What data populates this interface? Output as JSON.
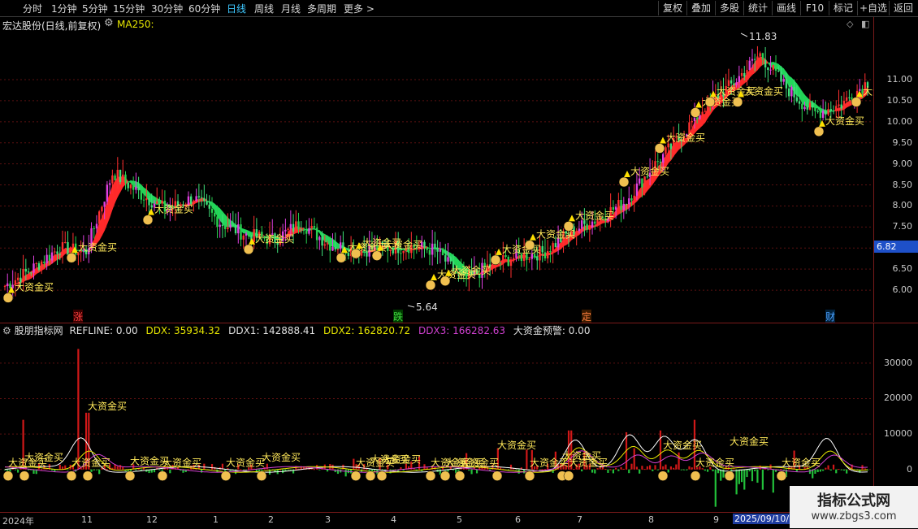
{
  "toolbar": {
    "periods": [
      "分时",
      "1分钟",
      "5分钟",
      "15分钟",
      "30分钟",
      "60分钟",
      "日线",
      "周线",
      "月线",
      "多周期",
      "更多 >"
    ],
    "active_period": "日线",
    "actions": [
      "复权",
      "叠加",
      "多股",
      "统计",
      "画线",
      "F10",
      "标记",
      "+自选",
      "返回"
    ]
  },
  "main_chart": {
    "title": "宏达股份(日线,前复权)",
    "indicator": "MA250:",
    "high_label": "11.83",
    "low_label": "5.64",
    "current_price": "6.82",
    "signal_label": "大资金买",
    "markers": [
      "涨",
      "跌",
      "定",
      "财"
    ]
  },
  "sub_chart": {
    "indicator_name": "股朋指标网",
    "refline": "REFLINE: 0.00",
    "ddx": "DDX: 35934.32",
    "ddx1": "DDX1: 142888.41",
    "ddx2": "DDX2: 162820.72",
    "ddx3": "DDX3: 166282.63",
    "warning": "大资金预警: 0.00"
  },
  "x_axis": {
    "year": "2024年",
    "months": [
      "11",
      "12",
      "1",
      "2",
      "3",
      "4",
      "5",
      "6",
      "7",
      "8",
      "9"
    ],
    "cursor_date": "2025/09/10/3"
  },
  "watermark": {
    "line1": "指标公式网",
    "line2": "www.zbgs3.com"
  },
  "chart_data": [
    {
      "type": "line",
      "title": "宏达股份(日线,前复权)",
      "y_ticks": [
        6.0,
        6.5,
        7.0,
        7.5,
        8.0,
        8.5,
        9.0,
        9.5,
        10.0,
        10.5,
        11.0
      ],
      "ylim": [
        5.5,
        12.1
      ],
      "series": [
        {
          "values": [
            6.1,
            6.5,
            7.0,
            6.9,
            8.8,
            8.3,
            7.9,
            8.2,
            7.6,
            7.3,
            7.2,
            7.6,
            7.1,
            6.95,
            7.0,
            7.05,
            6.95,
            6.2,
            6.6,
            6.8,
            6.9,
            7.4,
            7.7,
            8.1,
            8.9,
            9.6,
            10.4,
            10.9,
            11.6,
            10.8,
            10.2,
            10.4,
            10.95
          ]
        }
      ],
      "annotations": {
        "high": 11.83,
        "low": 5.64,
        "last": 6.82
      }
    },
    {
      "type": "line",
      "y_ticks": [
        0,
        10000,
        20000,
        30000
      ],
      "ylim": [
        -12000,
        38000
      ],
      "series": [
        {
          "name": "DDX",
          "values": [
            35934.32
          ]
        },
        {
          "name": "DDX1",
          "values": [
            142888.41
          ]
        },
        {
          "name": "DDX2",
          "values": [
            162820.72
          ]
        },
        {
          "name": "DDX3",
          "values": [
            166282.63
          ]
        }
      ]
    }
  ]
}
